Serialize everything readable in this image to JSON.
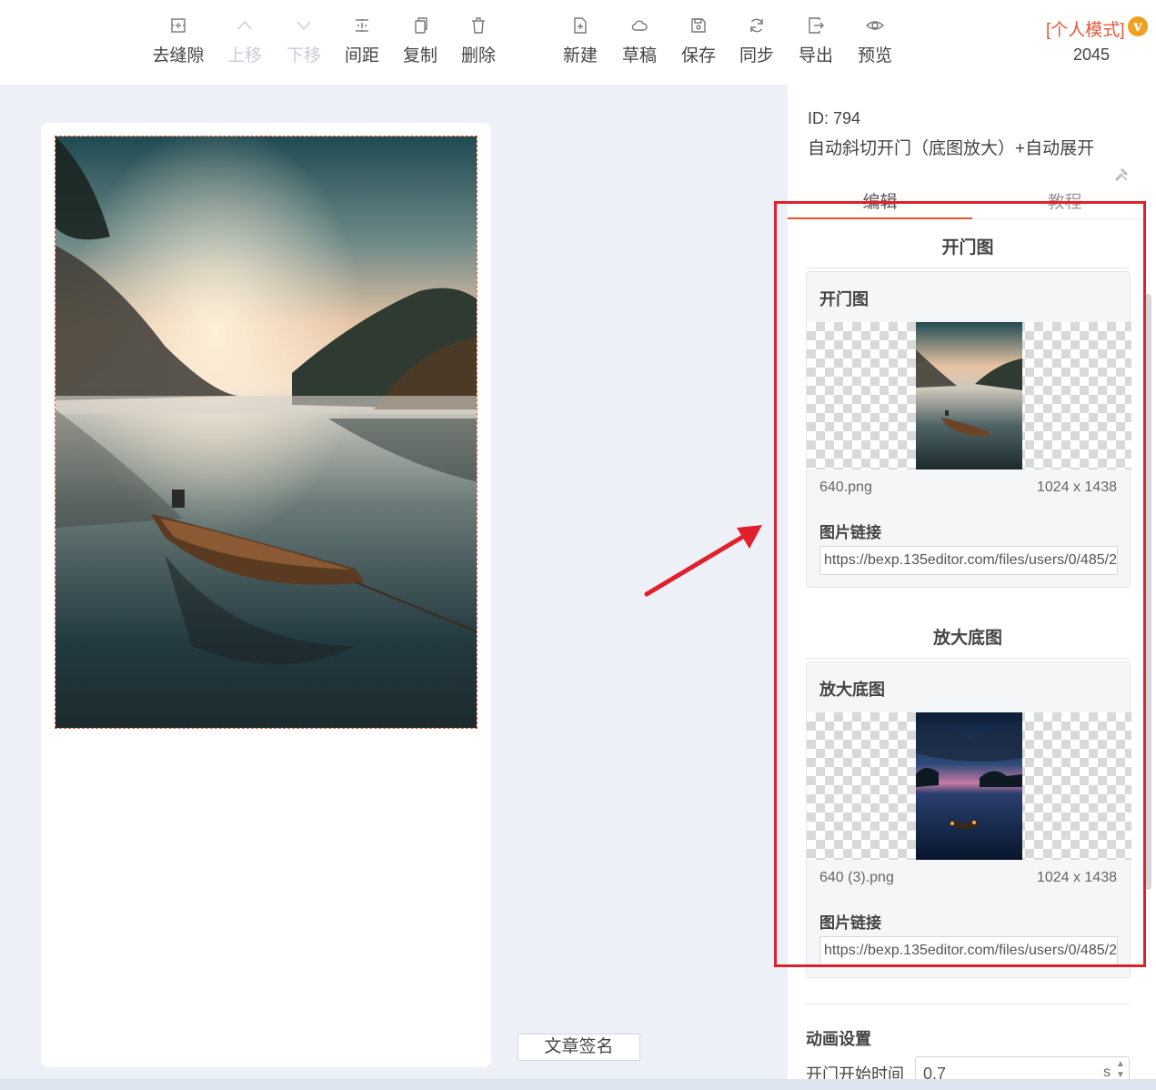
{
  "toolbar": {
    "items": [
      {
        "label": "去缝隙",
        "icon": "remove-gap-icon",
        "disabled": false
      },
      {
        "label": "上移",
        "icon": "chevron-up-icon",
        "disabled": true
      },
      {
        "label": "下移",
        "icon": "chevron-down-icon",
        "disabled": true
      },
      {
        "label": "间距",
        "icon": "spacing-icon",
        "disabled": false
      },
      {
        "label": "复制",
        "icon": "copy-icon",
        "disabled": false
      },
      {
        "label": "删除",
        "icon": "trash-icon",
        "disabled": false
      },
      {
        "label": "新建",
        "icon": "new-file-icon",
        "disabled": false
      },
      {
        "label": "草稿",
        "icon": "cloud-icon",
        "disabled": false
      },
      {
        "label": "保存",
        "icon": "save-icon",
        "disabled": false
      },
      {
        "label": "同步",
        "icon": "sync-icon",
        "disabled": false
      },
      {
        "label": "导出",
        "icon": "export-icon",
        "disabled": false
      },
      {
        "label": "预览",
        "icon": "eye-icon",
        "disabled": false
      }
    ],
    "mode_label": "[个人模式]",
    "vip_badge": "v",
    "count": "2045"
  },
  "canvas": {
    "signature_button": "文章签名"
  },
  "panel": {
    "id_label": "ID: 794",
    "template_name": "自动斜切开门（底图放大）+自动展开",
    "tabs": [
      {
        "label": "编辑",
        "active": true
      },
      {
        "label": "教程",
        "active": false
      }
    ],
    "sections": [
      {
        "heading": "开门图",
        "box_title": "开门图",
        "file_name": "640.png",
        "dimensions": "1024 x 1438",
        "link_label": "图片链接",
        "link_value": "https://bexp.135editor.com/files/users/0/485/2"
      },
      {
        "heading": "放大底图",
        "box_title": "放大底图",
        "file_name": "640 (3).png",
        "dimensions": "1024 x 1438",
        "link_label": "图片链接",
        "link_value": "https://bexp.135editor.com/files/users/0/485/2"
      }
    ],
    "animation": {
      "heading": "动画设置",
      "door_start_label": "开门开始时间",
      "door_start_value": "0.7",
      "unit": "s"
    }
  },
  "colors": {
    "accent": "#e4572e",
    "highlight_frame": "#e0202c",
    "background": "#edf0f7"
  }
}
